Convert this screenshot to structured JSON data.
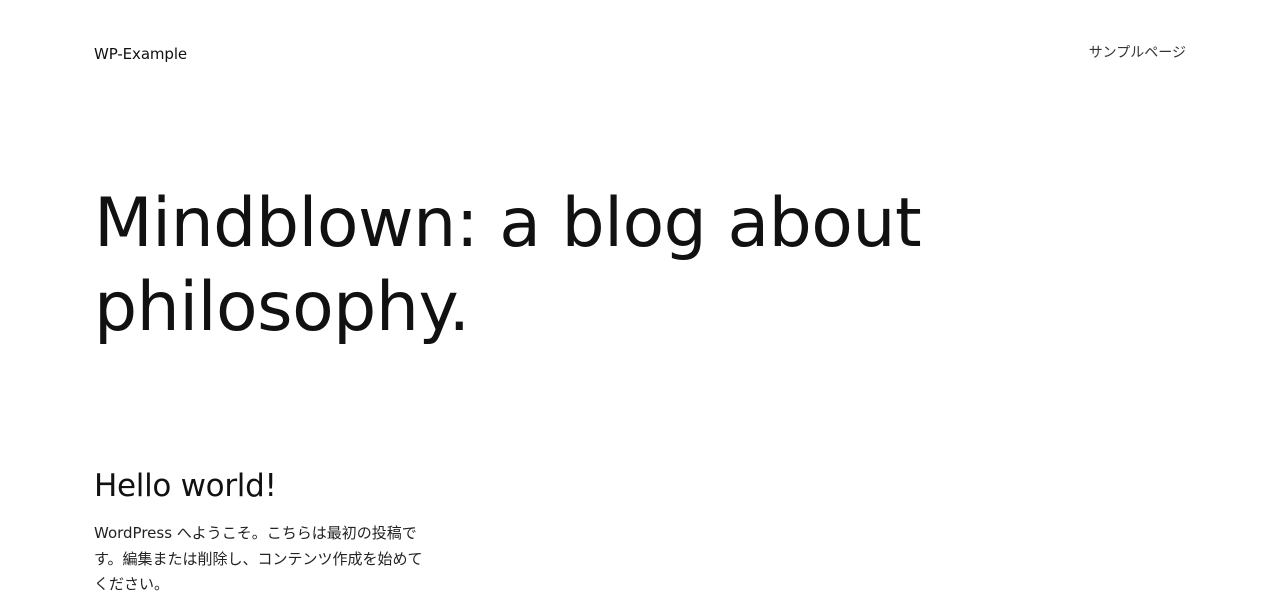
{
  "header": {
    "site_title": "WP-Example",
    "nav": {
      "sample_page_label": "サンプルページ"
    }
  },
  "hero": {
    "title": "Mindblown: a blog about philosophy."
  },
  "posts": [
    {
      "title": "Hello world!",
      "excerpt": "WordPress へようこそ。こちらは最初の投稿です。編集または削除し、コンテンツ作成を始めてください。"
    }
  ]
}
